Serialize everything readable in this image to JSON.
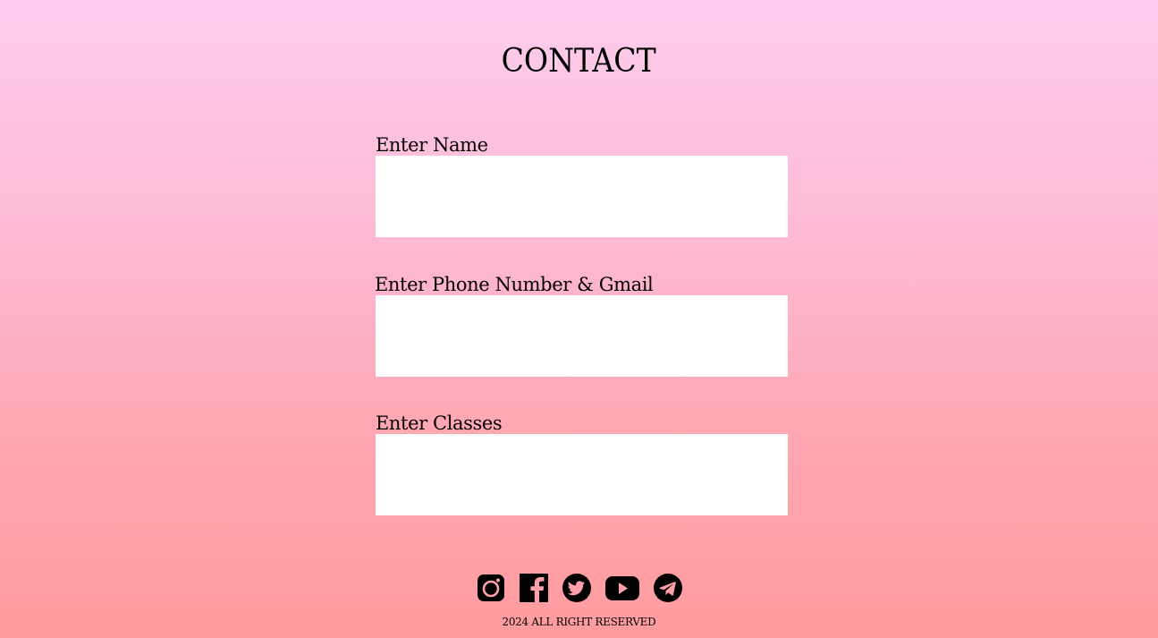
{
  "page": {
    "title": "CONTACT"
  },
  "form": {
    "fields": [
      {
        "label": "Enter Name",
        "value": "",
        "placeholder": ""
      },
      {
        "label": "Enter Phone Number & Gmail",
        "value": "",
        "placeholder": ""
      },
      {
        "label": "Enter Classes",
        "value": "",
        "placeholder": ""
      }
    ]
  },
  "socials": [
    {
      "icon": "instagram-icon"
    },
    {
      "icon": "facebook-icon"
    },
    {
      "icon": "twitter-icon"
    },
    {
      "icon": "youtube-icon"
    },
    {
      "icon": "telegram-icon"
    }
  ],
  "footer": {
    "copyright": "2024 ALL RIGHT RESERVED"
  },
  "colors": {
    "gradient_top": "#fecdee",
    "gradient_bottom": "#ff9b9e",
    "input_background": "#ffffff",
    "text": "#000000"
  }
}
